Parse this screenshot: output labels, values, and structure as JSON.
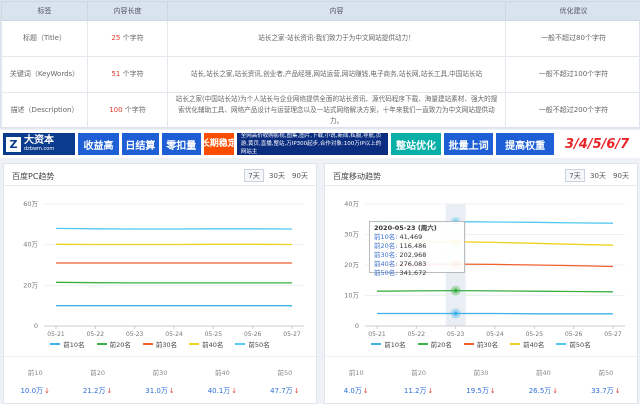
{
  "seo": {
    "headers": [
      "标签",
      "内容长度",
      "内容",
      "优化建议"
    ],
    "rows": [
      {
        "label": "标题（Title）",
        "count": "25",
        "unit": "个字符",
        "content": "站长之家-站长资讯-我们致力于为中文网站提供动力！",
        "advice": "一般不超过80个字符"
      },
      {
        "label": "关键词（KeyWords）",
        "count": "51",
        "unit": "个字符",
        "content": "站长,站长之家,站长资讯,创业者,产品经理,网站运营,网站赚钱,电子商务,站长网,站长工具,中国站长站",
        "advice": "一般不超过100个字符"
      },
      {
        "label": "描述（Description）",
        "count": "100",
        "unit": "个字符",
        "content": "站长之家(中国站长站)为个人站长与企业网络提供全面的站长资讯、源代码程序下载、海量建站素材、强大的搜索优化辅助工具、网络产品设计与运营理念以及一站式网络解决方案，十年来我们一直致力为中文网站提供动力。",
        "advice": "一般不超过200个字符"
      }
    ]
  },
  "banner": {
    "logo_main": "大资本",
    "logo_badge": "Z",
    "logo_sub": "dzbwm.com",
    "b1": "收益高",
    "b2": "日结算",
    "b3": "零扣量",
    "b4": "长期稳定",
    "b5": "全网高价收购影视,图集,图片,下载,小说,新闻,私服,导航,页游,黄页,直播,整站,万IP300起步,合作对象:100万IP以上的网站主",
    "b6": "整站优化",
    "b7": "批量上词",
    "b8": "提高权重",
    "b9": "3/4/5/6/7"
  },
  "panels": [
    {
      "title": "百度PC趋势",
      "tabs": [
        "7天",
        "30天",
        "90天"
      ],
      "active_tab": "7天",
      "legend": [
        "前10名",
        "前20名",
        "前30名",
        "前40名",
        "前50名"
      ],
      "stats": [
        {
          "label": "前10",
          "value": "10.0万"
        },
        {
          "label": "前20",
          "value": "21.2万"
        },
        {
          "label": "前30",
          "value": "31.0万"
        },
        {
          "label": "前40",
          "value": "40.1万"
        },
        {
          "label": "前50",
          "value": "47.7万"
        }
      ]
    },
    {
      "title": "百度移动趋势",
      "tabs": [
        "7天",
        "30天",
        "90天"
      ],
      "active_tab": "7天",
      "legend": [
        "前10名",
        "前20名",
        "前30名",
        "前40名",
        "前50名"
      ],
      "stats": [
        {
          "label": "前10",
          "value": "4.0万"
        },
        {
          "label": "前20",
          "value": "11.2万"
        },
        {
          "label": "前30",
          "value": "19.5万"
        },
        {
          "label": "前40",
          "value": "26.5万"
        },
        {
          "label": "前50",
          "value": "33.7万"
        }
      ],
      "tooltip": {
        "date": "2020-05-23 (周六)",
        "items": [
          {
            "label": "前10名",
            "value": "41,469"
          },
          {
            "label": "前20名",
            "value": "116,486"
          },
          {
            "label": "前30名",
            "value": "202,968"
          },
          {
            "label": "前40名",
            "value": "276,083"
          },
          {
            "label": "前50名",
            "value": "341,672"
          }
        ]
      }
    }
  ],
  "colors": {
    "top10": "#3fb0e8",
    "top20": "#3cb043",
    "top30": "#f0602b",
    "top40": "#f1d21e",
    "top50": "#52c9f0",
    "accent": "#2f6fd6",
    "down_arrow": "#e23c2c"
  },
  "chart_data": [
    {
      "type": "line",
      "title": "百度PC趋势",
      "x": [
        "05-21",
        "05-22",
        "05-23",
        "05-24",
        "05-25",
        "05-26",
        "05-27"
      ],
      "ylim": [
        0,
        60
      ],
      "yticks": [
        "0",
        "20万",
        "40万",
        "60万"
      ],
      "grid": true,
      "legend": "bottom",
      "series": [
        {
          "name": "前10名",
          "color": "#3fb0e8",
          "values": [
            10.0,
            10.0,
            10.0,
            10.0,
            10.0,
            10.0,
            10.0
          ]
        },
        {
          "name": "前20名",
          "color": "#3cb043",
          "values": [
            21.5,
            21.3,
            21.2,
            21.2,
            21.2,
            21.2,
            21.2
          ]
        },
        {
          "name": "前30名",
          "color": "#f0602b",
          "values": [
            31.0,
            31.0,
            31.0,
            31.0,
            31.0,
            31.0,
            31.0
          ]
        },
        {
          "name": "前40名",
          "color": "#f1d21e",
          "values": [
            40.2,
            40.1,
            40.1,
            40.1,
            40.2,
            40.2,
            40.1
          ]
        },
        {
          "name": "前50名",
          "color": "#52c9f0",
          "values": [
            48.0,
            47.8,
            47.7,
            47.7,
            47.8,
            47.8,
            47.7
          ]
        }
      ]
    },
    {
      "type": "line",
      "title": "百度移动趋势",
      "x": [
        "05-21",
        "05-22",
        "05-23",
        "05-24",
        "05-25",
        "05-26",
        "05-27"
      ],
      "ylim": [
        0,
        40
      ],
      "yticks": [
        "0",
        "10万",
        "20万",
        "30万",
        "40万"
      ],
      "grid": true,
      "legend": "bottom",
      "series": [
        {
          "name": "前10名",
          "color": "#3fb0e8",
          "values": [
            4.1,
            4.1,
            4.1,
            4.1,
            4.0,
            4.0,
            4.0
          ]
        },
        {
          "name": "前20名",
          "color": "#3cb043",
          "values": [
            11.4,
            11.5,
            11.6,
            11.5,
            11.4,
            11.3,
            11.2
          ]
        },
        {
          "name": "前30名",
          "color": "#f0602b",
          "values": [
            20.0,
            20.2,
            20.3,
            20.2,
            20.0,
            19.8,
            19.5
          ]
        },
        {
          "name": "前40名",
          "color": "#f1d21e",
          "values": [
            27.3,
            27.5,
            27.6,
            27.4,
            27.1,
            26.8,
            26.5
          ]
        },
        {
          "name": "前50名",
          "color": "#52c9f0",
          "values": [
            33.8,
            34.0,
            34.2,
            34.1,
            34.0,
            33.8,
            33.7
          ]
        }
      ],
      "highlight_index": 2
    }
  ]
}
